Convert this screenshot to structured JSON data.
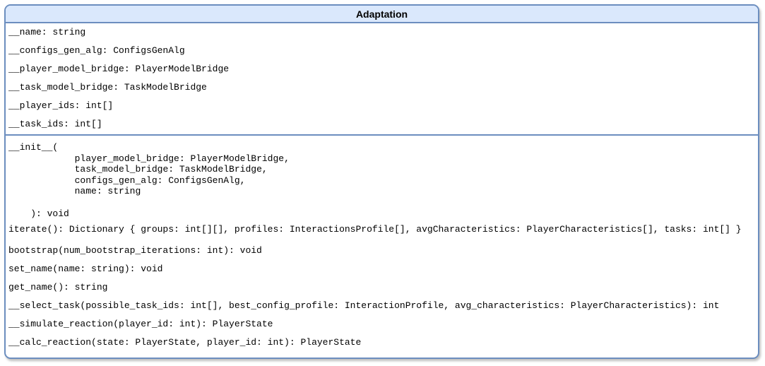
{
  "class_name": "Adaptation",
  "attributes": [
    "__name: string",
    "__configs_gen_alg: ConfigsGenAlg",
    "__player_model_bridge: PlayerModelBridge",
    "__task_model_bridge: TaskModelBridge",
    "__player_ids: int[]",
    "__task_ids: int[]"
  ],
  "init_method": {
    "open": "__init__(",
    "params": [
      "player_model_bridge: PlayerModelBridge,",
      "task_model_bridge: TaskModelBridge,",
      "configs_gen_alg: ConfigsGenAlg,",
      "name: string"
    ],
    "close": "): void"
  },
  "methods": [
    "iterate(): Dictionary { groups: int[][], profiles: InteractionsProfile[], avgCharacteristics: PlayerCharacteristics[], tasks: int[] }",
    "bootstrap(num_bootstrap_iterations: int): void",
    "set_name(name: string): void",
    "get_name(): string",
    "__select_task(possible_task_ids: int[], best_config_profile: InteractionProfile, avg_characteristics: PlayerCharacteristics): int",
    "__simulate_reaction(player_id: int): PlayerState",
    "__calc_reaction(state: PlayerState, player_id: int): PlayerState"
  ],
  "colors": {
    "border": "#6c8ebf",
    "header_fill": "#dae8fc"
  }
}
